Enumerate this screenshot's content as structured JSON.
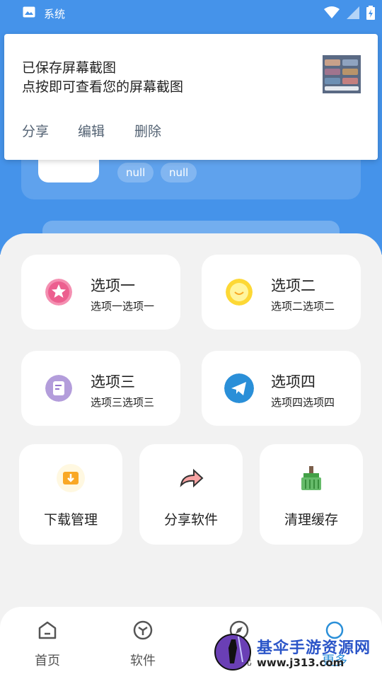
{
  "status_bar": {
    "app_label": "系统"
  },
  "notification": {
    "line1": "已保存屏幕截图",
    "line2": "点按即可查看您的屏幕截图",
    "actions": [
      "分享",
      "编辑",
      "删除"
    ]
  },
  "profile": {
    "tags": [
      "null",
      "null"
    ]
  },
  "options": [
    {
      "title": "选项一",
      "subtitle": "选项一选项一",
      "icon": "pink-star-icon",
      "color": "#f06292"
    },
    {
      "title": "选项二",
      "subtitle": "选项二选项二",
      "icon": "yellow-chat-icon",
      "color": "#fbc02d"
    },
    {
      "title": "选项三",
      "subtitle": "选项三选项三",
      "icon": "purple-note-icon",
      "color": "#9575cd"
    },
    {
      "title": "选项四",
      "subtitle": "选项四选项四",
      "icon": "telegram-icon",
      "color": "#2a8fd8"
    }
  ],
  "tools": [
    {
      "label": "下载管理",
      "icon": "download-folder-icon"
    },
    {
      "label": "分享软件",
      "icon": "share-arrow-icon"
    },
    {
      "label": "清理缓存",
      "icon": "broom-icon"
    }
  ],
  "bottom_nav": [
    {
      "label": "首页",
      "icon": "home-icon"
    },
    {
      "label": "软件",
      "icon": "cube-icon"
    },
    {
      "label": "发现",
      "icon": "compass-icon"
    },
    {
      "label": "更多",
      "icon": "more-icon"
    }
  ],
  "watermark": {
    "title": "基伞手游资源网",
    "url": "www.j313.com"
  }
}
